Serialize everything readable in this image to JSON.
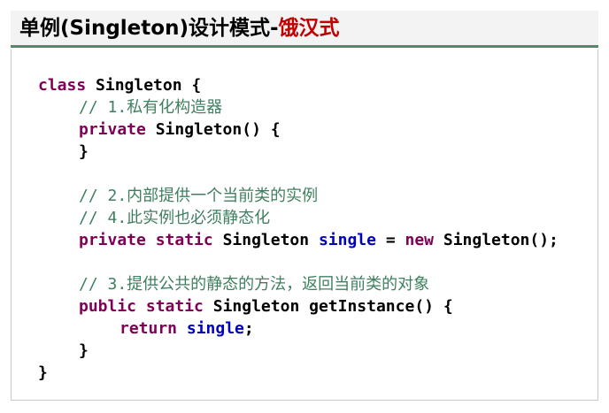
{
  "title": {
    "main": "单例(Singleton)设计模式-",
    "accent": "饿汉式"
  },
  "code": {
    "l1_kw": "class",
    "l1_rest": " Singleton {",
    "l2_comment": "// 1.私有化构造器",
    "l3_kw": "private",
    "l3_rest": " Singleton() {",
    "l4": "}",
    "l5_comment": "// 2.内部提供一个当前类的实例",
    "l6_comment": "// 4.此实例也必须静态化",
    "l7_kw1": "private",
    "l7_kw2": "static",
    "l7_type": " Singleton ",
    "l7_field": "single",
    "l7_eq": " = ",
    "l7_kw3": "new",
    "l7_rest": " Singleton();",
    "l8_comment": "// 3.提供公共的静态的方法，返回当前类的对象",
    "l9_kw1": "public",
    "l9_kw2": "static",
    "l9_rest": " Singleton getInstance() {",
    "l10_kw": "return",
    "l10_field": "single",
    "l10_semi": ";",
    "l11": "}",
    "l12": "}"
  },
  "colors": {
    "keyword": "#7f0055",
    "comment": "#3f7f5f",
    "field": "#0000c0",
    "title_accent": "#c00000",
    "title_rule": "#4f8a6b"
  }
}
